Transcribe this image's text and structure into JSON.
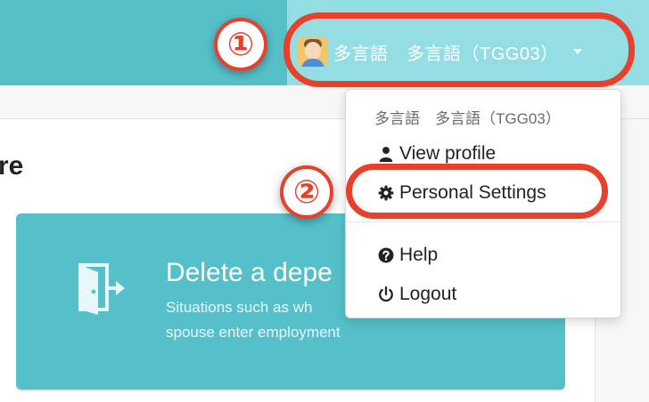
{
  "header": {
    "user_display_name": "多言語　多言語（TGG03）",
    "avatar_icon": "user-avatar-icon",
    "caret_icon": "caret-down-icon"
  },
  "annotations": {
    "step_1": "①",
    "step_2": "②",
    "ring_color": "#e8402a"
  },
  "main": {
    "section_heading": "re",
    "card": {
      "icon": "door-exit-icon",
      "title": "Delete a depe",
      "description": "Situations such as wh spouse enter employment"
    }
  },
  "user_menu": {
    "header": "多言語　多言語（TGG03）",
    "items": [
      {
        "label": "View profile",
        "icon": "user-icon"
      },
      {
        "label": "Personal Settings",
        "icon": "gear-icon"
      },
      {
        "label": "Help",
        "icon": "question-circle-icon"
      },
      {
        "label": "Logout",
        "icon": "power-icon"
      }
    ]
  },
  "colors": {
    "topbar": "#56c0c9",
    "topbar_user_area": "#93dde3",
    "card": "#55c0c9",
    "annotation": "#e8402a"
  }
}
